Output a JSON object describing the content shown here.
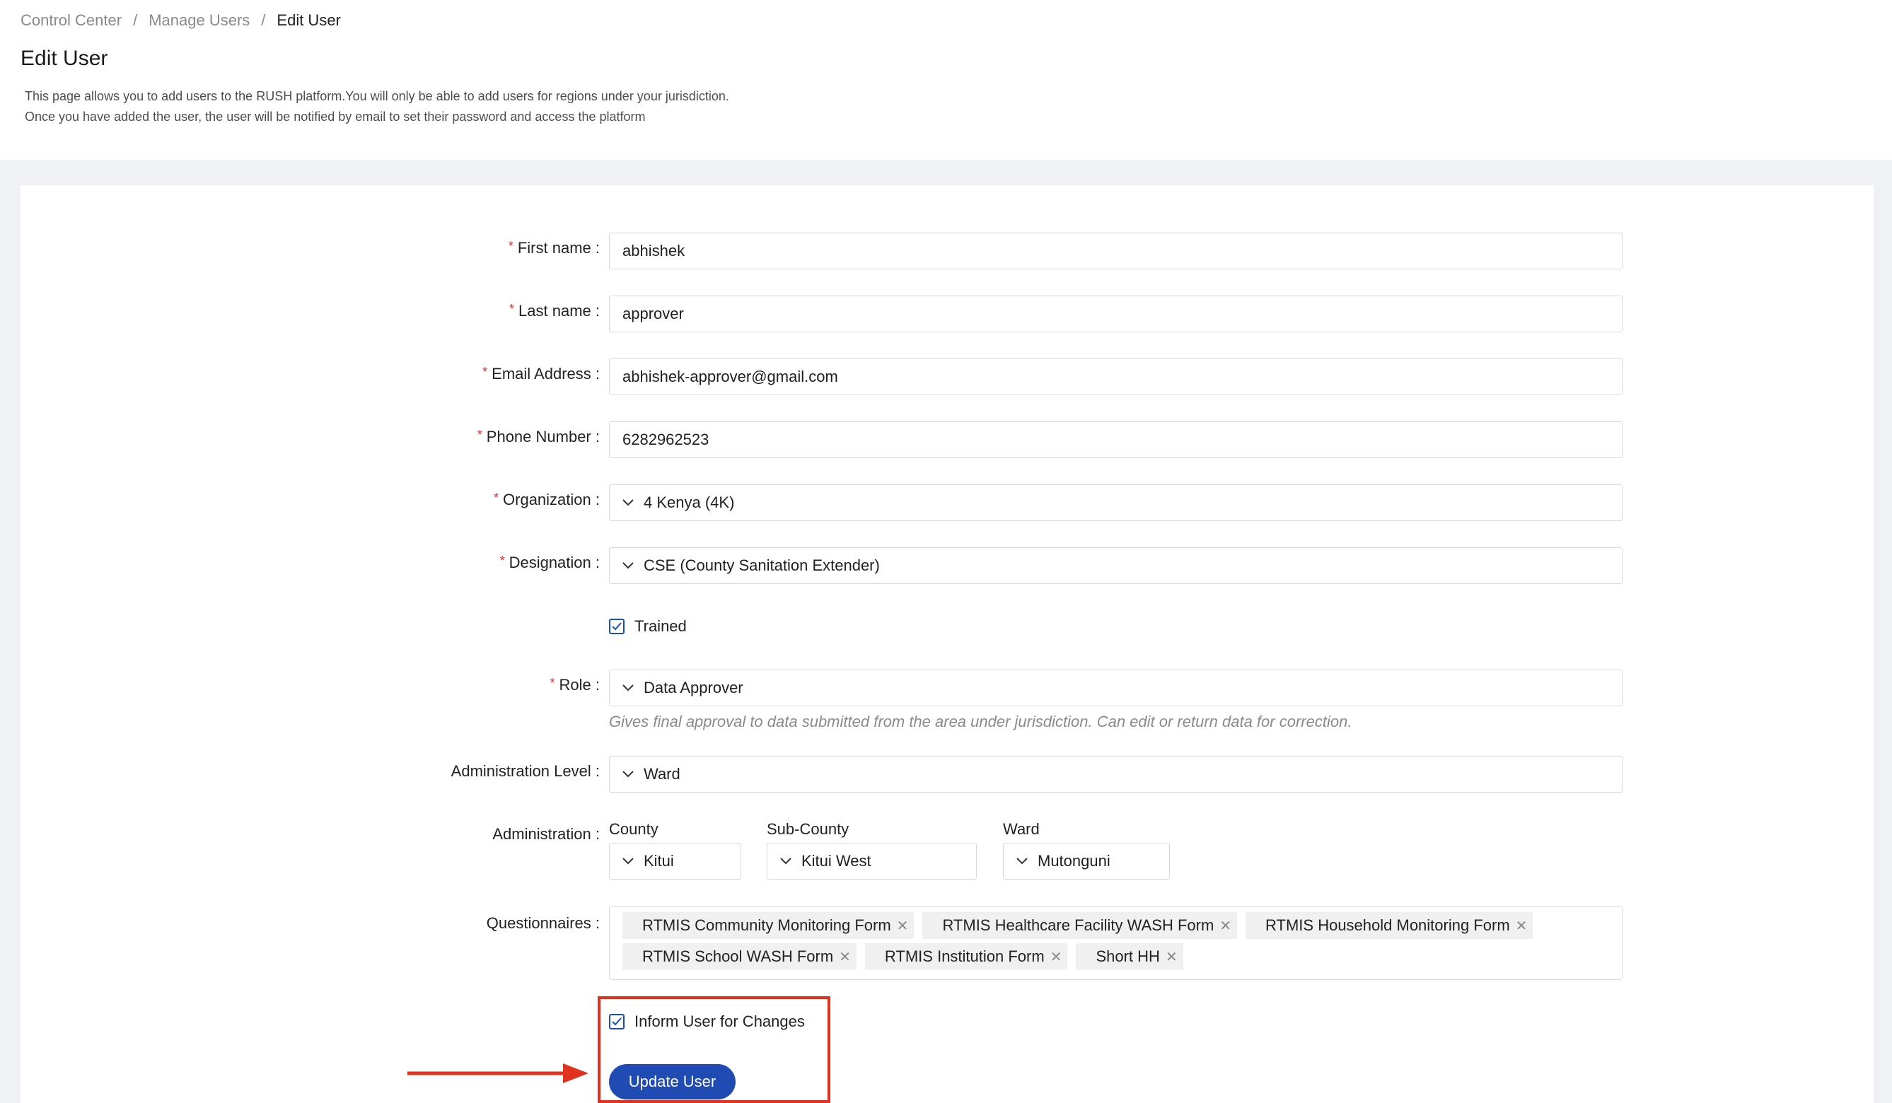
{
  "breadcrumb": {
    "items": [
      "Control Center",
      "Manage Users"
    ],
    "separator": "/",
    "current": "Edit User"
  },
  "page": {
    "title": "Edit User",
    "description_line1": "This page allows you to add users to the RUSH platform.You will only be able to add users for regions under your jurisdiction.",
    "description_line2": "Once you have added the user, the user will be notified by email to set their password and access the platform"
  },
  "form": {
    "required_mark": "*",
    "first_name": {
      "label": "First name",
      "value": "abhishek"
    },
    "last_name": {
      "label": "Last name",
      "value": "approver"
    },
    "email": {
      "label": "Email Address",
      "value": "abhishek-approver@gmail.com"
    },
    "phone": {
      "label": "Phone Number",
      "value": "6282962523"
    },
    "organization": {
      "label": "Organization",
      "value": "4 Kenya (4K)"
    },
    "designation": {
      "label": "Designation",
      "value": "CSE (County Sanitation Extender)"
    },
    "trained": {
      "label": "Trained",
      "checked": true
    },
    "role": {
      "label": "Role",
      "value": "Data Approver",
      "hint": "Gives final approval to data submitted from the area under jurisdiction. Can edit or return data for correction."
    },
    "admin_level": {
      "label": "Administration Level",
      "value": "Ward"
    },
    "administration": {
      "label": "Administration",
      "county": {
        "label": "County",
        "value": "Kitui"
      },
      "sub_county": {
        "label": "Sub-County",
        "value": "Kitui West"
      },
      "ward": {
        "label": "Ward",
        "value": "Mutonguni"
      }
    },
    "questionnaires": {
      "label": "Questionnaires",
      "tags": [
        "RTMIS Community Monitoring Form",
        "RTMIS Healthcare Facility WASH Form",
        "RTMIS Household Monitoring Form",
        "RTMIS School WASH Form",
        "RTMIS Institution Form",
        "Short HH"
      ]
    },
    "inform_user": {
      "label": "Inform User for Changes",
      "checked": true
    },
    "submit_label": "Update User"
  },
  "colors": {
    "primary": "#1f4bb3",
    "required": "#e0312b",
    "annotation": "#e0331f"
  },
  "icons": {
    "chevron": "chevron-down-icon",
    "check": "check-icon",
    "close": "close-icon",
    "arrow": "arrow-right-icon"
  }
}
